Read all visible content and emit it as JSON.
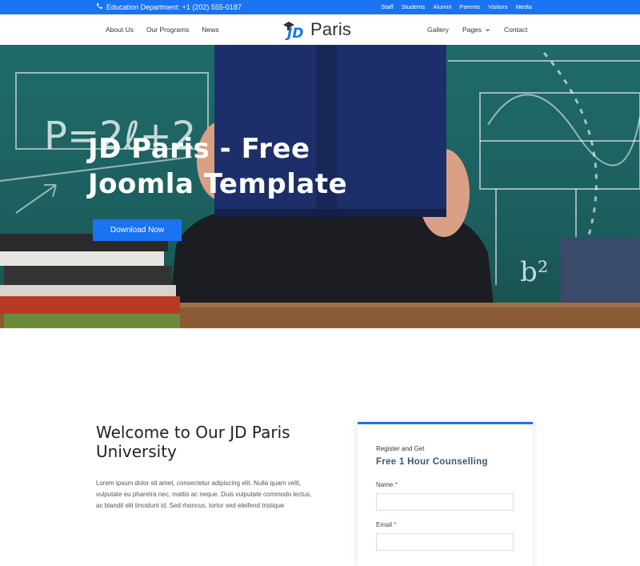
{
  "topbar": {
    "contact_text": "Education Department: +1 (202) 555-0187",
    "links": [
      "Staff",
      "Students",
      "Alumni",
      "Parents",
      "Visitors",
      "Media"
    ]
  },
  "nav": {
    "left": [
      "About Us",
      "Our Programs",
      "News"
    ],
    "right": {
      "gallery": "Gallery",
      "pages": "Pages",
      "contact": "Contact"
    },
    "logo": {
      "mark": "JD",
      "text": "Paris"
    }
  },
  "hero": {
    "title_line1": "JD Paris - Free",
    "title_line2": "Joomla Template",
    "button": "Download Now",
    "board_text": {
      "formula1": "P=2ℓ+2",
      "formula2": "b²"
    }
  },
  "welcome": {
    "title": "Welcome to Our JD Paris University",
    "body": "Lorem ipsum dolor sit amet, consectetur adipiscing elit. Nulla quam velit, vulputate eu pharetra nec, mattis ac neque. Duis vulputate commodo lectus, ac blandit elit tincidunt id. Sed rhoncus, tortor sed eleifend tristique"
  },
  "form": {
    "kicker": "Register and Get",
    "title": "Free 1 Hour Counselling",
    "fields": [
      {
        "label": "Name",
        "required": "*",
        "value": ""
      },
      {
        "label": "Email",
        "required": "*",
        "value": ""
      }
    ]
  },
  "colors": {
    "accent": "#1a73f0",
    "form_title": "#3c5770",
    "hero_board": "#1f6b6a"
  },
  "icons": [
    "phone-icon",
    "chevron-down-icon",
    "graduation-cap-icon"
  ]
}
